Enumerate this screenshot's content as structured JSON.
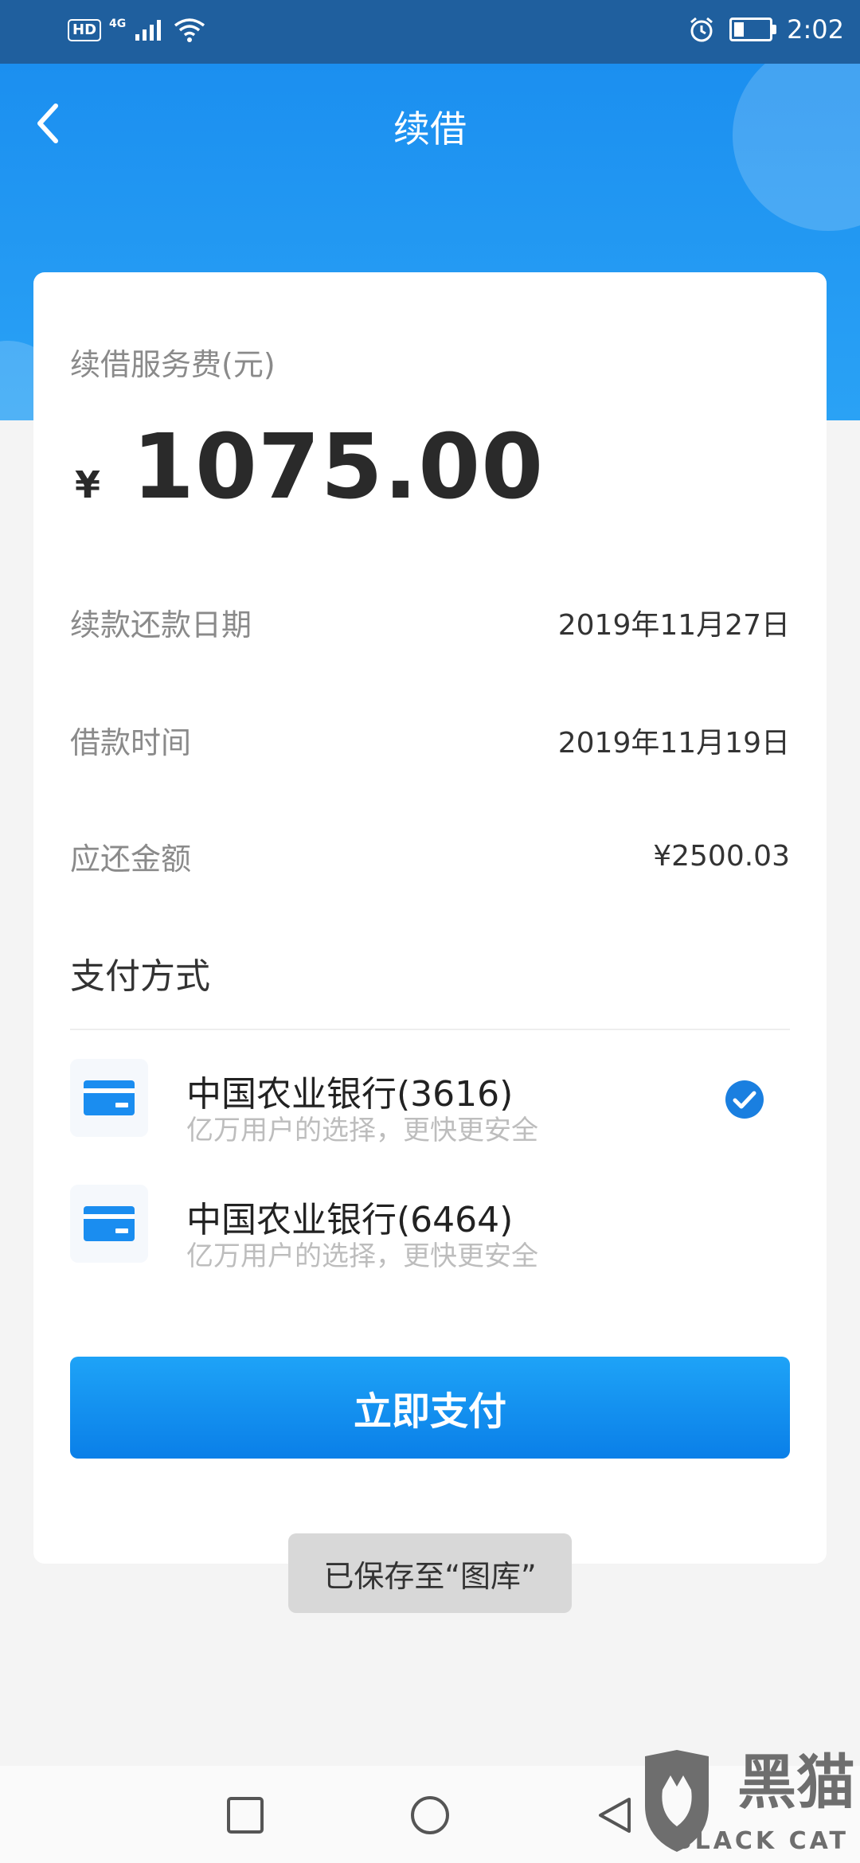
{
  "status_bar": {
    "hd": "HD",
    "network": "4G",
    "time": "2:02"
  },
  "header": {
    "title": "续借"
  },
  "fee": {
    "label": "续借服务费(元)",
    "currency": "¥",
    "amount": "1075.00"
  },
  "details": [
    {
      "label": "续款还款日期",
      "value": "2019年11月27日"
    },
    {
      "label": "借款时间",
      "value": "2019年11月19日"
    },
    {
      "label": "应还金额",
      "value": "¥2500.03"
    }
  ],
  "payment": {
    "section_title": "支付方式",
    "methods": [
      {
        "name": "中国农业银行(3616)",
        "subtitle": "亿万用户的选择，更快更安全",
        "selected": true
      },
      {
        "name": "中国农业银行(6464)",
        "subtitle": "亿万用户的选择，更快更安全",
        "selected": false
      }
    ],
    "pay_button": "立即支付"
  },
  "toast": "已保存至“图库”",
  "watermark": {
    "text_cn": "黑猫",
    "text_en": "BLACK CAT"
  },
  "colors": {
    "primary": "#1b8ff0",
    "check": "#1a7fe0",
    "card_icon": "#1a8df0"
  },
  "icons": {
    "back": "chevron-left-icon",
    "card": "bank-card-icon",
    "check": "check-circle-icon",
    "nav": [
      "square-recent-icon",
      "circle-home-icon",
      "triangle-back-icon"
    ]
  }
}
